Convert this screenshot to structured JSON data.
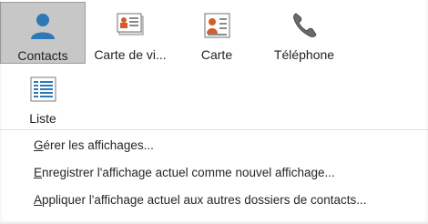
{
  "gallery": {
    "items": [
      {
        "label": "Contacts",
        "icon": "person-icon",
        "selected": true
      },
      {
        "label": "Carte de vi...",
        "icon": "business-card-icon",
        "selected": false
      },
      {
        "label": "Carte",
        "icon": "contact-card-icon",
        "selected": false
      },
      {
        "label": "Téléphone",
        "icon": "phone-icon",
        "selected": false
      },
      {
        "label": "Liste",
        "icon": "list-icon",
        "selected": false
      }
    ]
  },
  "menu": {
    "items": [
      {
        "label": "Gérer les affichages...",
        "mnemonic": "G"
      },
      {
        "label": "Enregistrer l'affichage actuel comme nouvel affichage...",
        "mnemonic": "E"
      },
      {
        "label": "Appliquer l'affichage actuel aux autres dossiers de contacts...",
        "mnemonic": "A"
      }
    ]
  },
  "colors": {
    "selected_bg": "#c7c7c7",
    "icon_blue": "#2e78b8",
    "contact_red": "#d85b2d"
  }
}
